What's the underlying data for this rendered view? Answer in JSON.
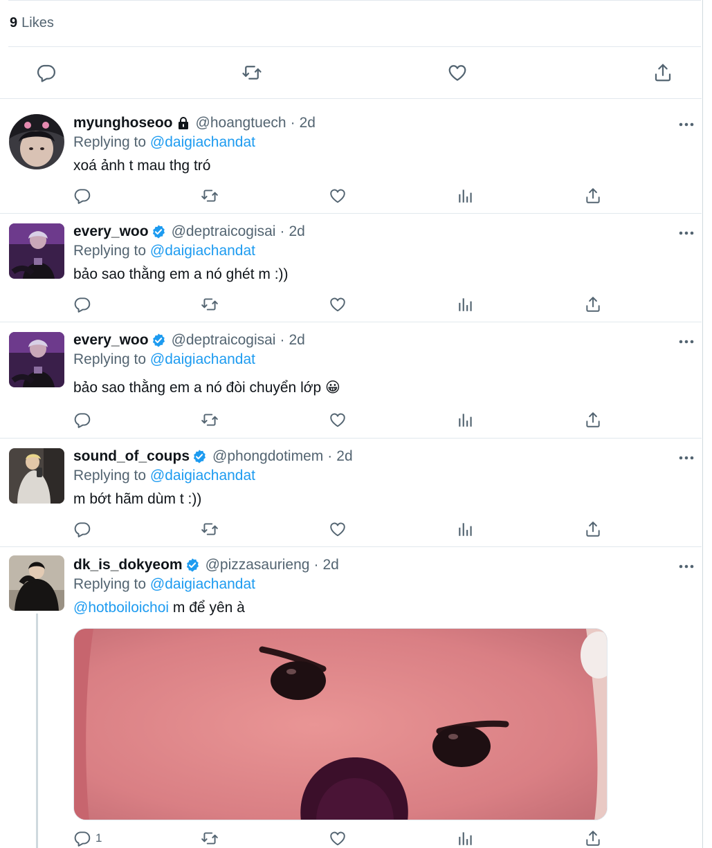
{
  "likes": {
    "count": "9",
    "label": "Likes"
  },
  "main_actions": {
    "reply_icon": "reply-icon",
    "retweet_icon": "retweet-icon",
    "like_icon": "heart-icon",
    "share_icon": "share-icon"
  },
  "colors": {
    "link": "#1d9bf0",
    "secondary_text": "#536471",
    "primary_text": "#0f1419",
    "divider": "#e1e8ed",
    "verified": "#1d9bf0"
  },
  "replies": [
    {
      "username": "myunghoseoo",
      "handle": "@hoangtuech",
      "time": "2d",
      "protected": true,
      "verified": false,
      "replying_label": "Replying to",
      "replying_to": "@daigiachandat",
      "text": "xoá ảnh t mau thg tró"
    },
    {
      "username": "every_woo",
      "handle": "@deptraicogisai",
      "time": "2d",
      "protected": false,
      "verified": true,
      "replying_label": "Replying to",
      "replying_to": "@daigiachandat",
      "text": "bảo sao thằng em a nó ghét m :))"
    },
    {
      "username": "every_woo",
      "handle": "@deptraicogisai",
      "time": "2d",
      "protected": false,
      "verified": true,
      "replying_label": "Replying to",
      "replying_to": "@daigiachandat",
      "text": "bảo sao thằng em a nó đòi chuyển lớp 😀"
    },
    {
      "username": "sound_of_coups",
      "handle": "@phongdotimem",
      "time": "2d",
      "protected": false,
      "verified": true,
      "replying_label": "Replying to",
      "replying_to": "@daigiachandat",
      "text": "m bớt hãm dùm t :))"
    },
    {
      "username": "dk_is_dokyeom",
      "handle": "@pizzasaurieng",
      "time": "2d",
      "protected": false,
      "verified": true,
      "replying_label": "Replying to",
      "replying_to": "@daigiachandat",
      "mention": "@hotboiloichoi",
      "text": "m để yên à",
      "has_media": true,
      "reply_count": "1"
    }
  ]
}
